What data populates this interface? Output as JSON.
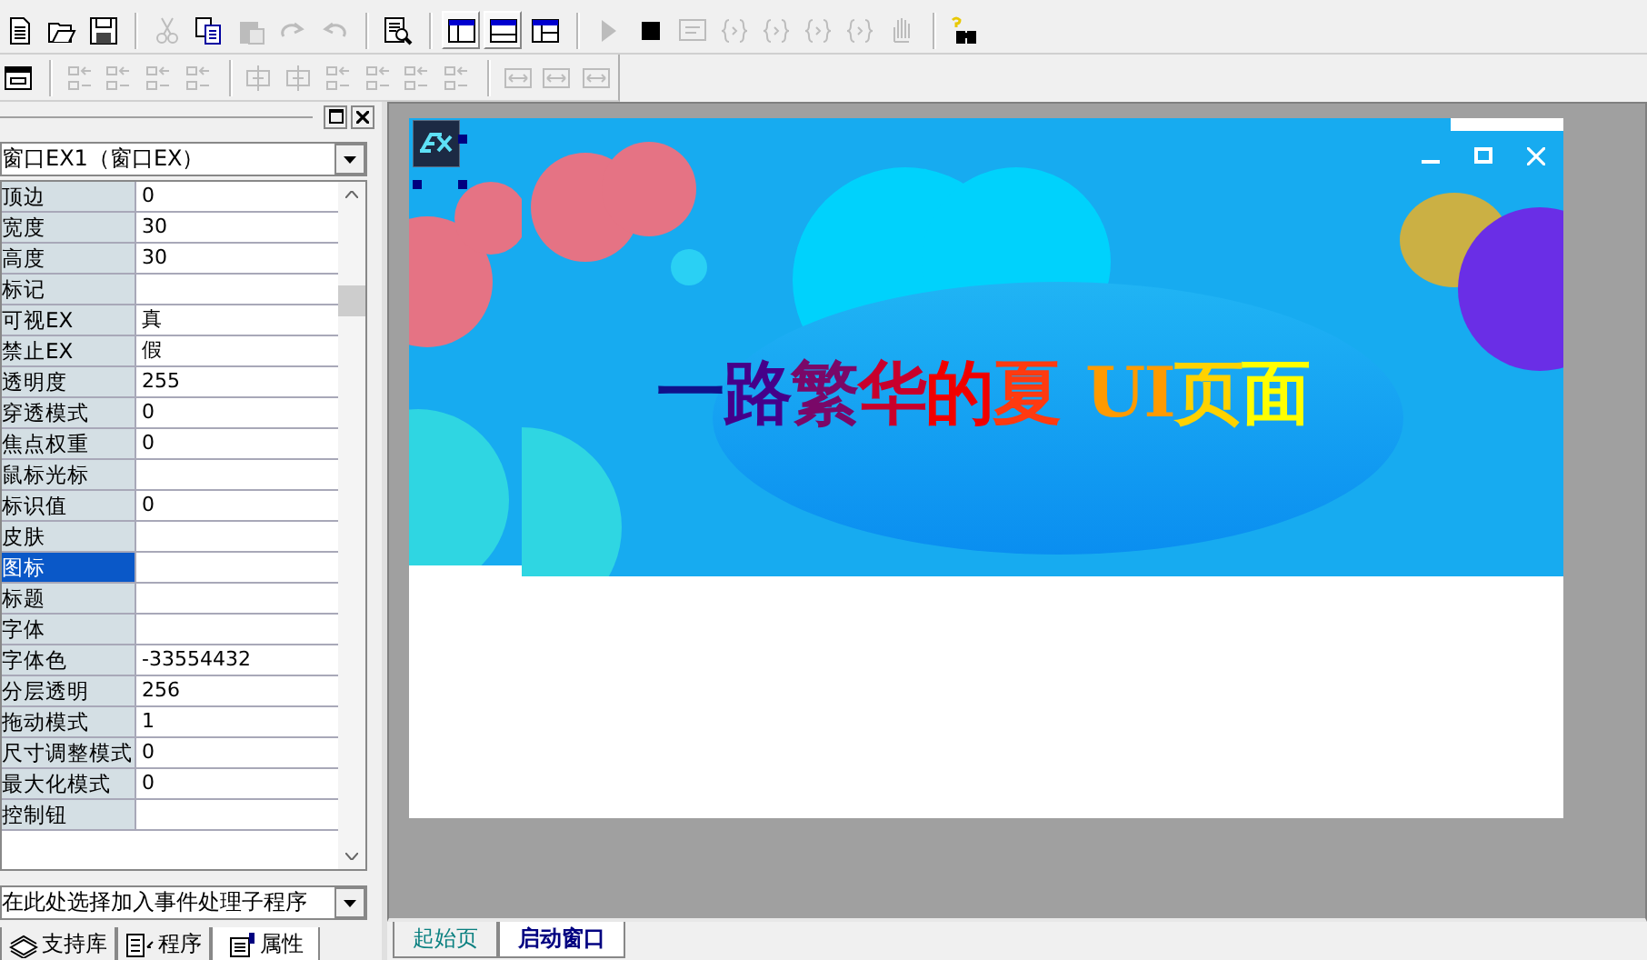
{
  "toolbars": [
    {
      "items": [
        {
          "kind": "new",
          "disabled": false,
          "pressed": false
        },
        {
          "kind": "open",
          "disabled": false,
          "pressed": false
        },
        {
          "kind": "save",
          "disabled": false,
          "pressed": false
        },
        {
          "kind": "sep"
        },
        {
          "kind": "cut",
          "disabled": true,
          "pressed": false
        },
        {
          "kind": "copy",
          "disabled": false,
          "pressed": false
        },
        {
          "kind": "paste",
          "disabled": true,
          "pressed": false
        },
        {
          "kind": "redo",
          "disabled": true,
          "pressed": false
        },
        {
          "kind": "undo",
          "disabled": true,
          "pressed": false
        },
        {
          "kind": "sep"
        },
        {
          "kind": "find",
          "disabled": false,
          "pressed": false
        },
        {
          "kind": "sep"
        },
        {
          "kind": "layout-a",
          "disabled": false,
          "pressed": true
        },
        {
          "kind": "layout-b",
          "disabled": false,
          "pressed": true
        },
        {
          "kind": "layout-c",
          "disabled": false,
          "pressed": false
        },
        {
          "kind": "sep"
        },
        {
          "kind": "run",
          "disabled": true,
          "pressed": false
        },
        {
          "kind": "stop",
          "disabled": false,
          "pressed": false
        },
        {
          "kind": "debug",
          "disabled": true,
          "pressed": false
        },
        {
          "kind": "step",
          "disabled": true,
          "pressed": false
        },
        {
          "kind": "step",
          "disabled": true,
          "pressed": false
        },
        {
          "kind": "step",
          "disabled": true,
          "pressed": false
        },
        {
          "kind": "step",
          "disabled": true,
          "pressed": false
        },
        {
          "kind": "hand",
          "disabled": true,
          "pressed": false
        },
        {
          "kind": "sep"
        },
        {
          "kind": "help",
          "disabled": false,
          "pressed": false
        }
      ]
    },
    {
      "items": [
        {
          "kind": "form",
          "disabled": false,
          "pressed": false
        },
        {
          "kind": "sep"
        },
        {
          "kind": "align",
          "disabled": true,
          "pressed": false
        },
        {
          "kind": "align",
          "disabled": true,
          "pressed": false
        },
        {
          "kind": "align",
          "disabled": true,
          "pressed": false
        },
        {
          "kind": "align",
          "disabled": true,
          "pressed": false
        },
        {
          "kind": "sep"
        },
        {
          "kind": "center",
          "disabled": true,
          "pressed": false
        },
        {
          "kind": "center",
          "disabled": true,
          "pressed": false
        },
        {
          "kind": "align",
          "disabled": true,
          "pressed": false
        },
        {
          "kind": "align",
          "disabled": true,
          "pressed": false
        },
        {
          "kind": "align",
          "disabled": true,
          "pressed": false
        },
        {
          "kind": "align",
          "disabled": true,
          "pressed": false
        },
        {
          "kind": "sep"
        },
        {
          "kind": "size",
          "disabled": true,
          "pressed": false
        },
        {
          "kind": "size",
          "disabled": true,
          "pressed": false
        },
        {
          "kind": "size",
          "disabled": true,
          "pressed": false
        }
      ]
    }
  ],
  "properties": {
    "object": "窗口EX1（窗口EX）",
    "rows": [
      {
        "name": "顶边",
        "value": "0",
        "selected": false
      },
      {
        "name": "宽度",
        "value": "30",
        "selected": false
      },
      {
        "name": "高度",
        "value": "30",
        "selected": false
      },
      {
        "name": "标记",
        "value": "",
        "selected": false
      },
      {
        "name": "可视EX",
        "value": "真",
        "selected": false
      },
      {
        "name": "禁止EX",
        "value": "假",
        "selected": false
      },
      {
        "name": "透明度",
        "value": "255",
        "selected": false
      },
      {
        "name": "穿透模式",
        "value": "0",
        "selected": false
      },
      {
        "name": "焦点权重",
        "value": "0",
        "selected": false
      },
      {
        "name": "鼠标光标",
        "value": "",
        "selected": false
      },
      {
        "name": "标识值",
        "value": "0",
        "selected": false
      },
      {
        "name": "皮肤",
        "value": "",
        "selected": false
      },
      {
        "name": "图标",
        "value": "",
        "selected": true
      },
      {
        "name": "标题",
        "value": "",
        "selected": false
      },
      {
        "name": "字体",
        "value": "",
        "selected": false
      },
      {
        "name": "字体色",
        "value": "-33554432",
        "selected": false
      },
      {
        "name": "分层透明",
        "value": "256",
        "selected": false
      },
      {
        "name": "拖动模式",
        "value": "1",
        "selected": false
      },
      {
        "name": "尺寸调整模式",
        "value": "0",
        "selected": false
      },
      {
        "name": "最大化模式",
        "value": "0",
        "selected": false
      },
      {
        "name": "控制钮",
        "value": "",
        "selected": false
      }
    ],
    "event_select": "在此处选择加入事件处理子程序",
    "tabs": [
      {
        "label": "支持库",
        "kind": "library",
        "selected": false
      },
      {
        "label": "程序",
        "kind": "program",
        "selected": false
      },
      {
        "label": "属性",
        "kind": "property",
        "selected": true
      }
    ]
  },
  "designer": {
    "banner_title": [
      {
        "text": "一",
        "color": "#10108a"
      },
      {
        "text": "路",
        "color": "#45008a"
      },
      {
        "text": "繁",
        "color": "#7a0868"
      },
      {
        "text": "华",
        "color": "#c8002c"
      },
      {
        "text": "的",
        "color": "#f00000"
      },
      {
        "text": "夏",
        "color": "#ff3a10"
      },
      {
        "text": "UI",
        "color": "#ff9a00"
      },
      {
        "text": "页",
        "color": "#ffd200"
      },
      {
        "text": "面",
        "color": "#ffff00"
      }
    ]
  },
  "editor_tabs": [
    {
      "label": "起始页",
      "selected": false
    },
    {
      "label": "启动窗口",
      "selected": true
    }
  ]
}
